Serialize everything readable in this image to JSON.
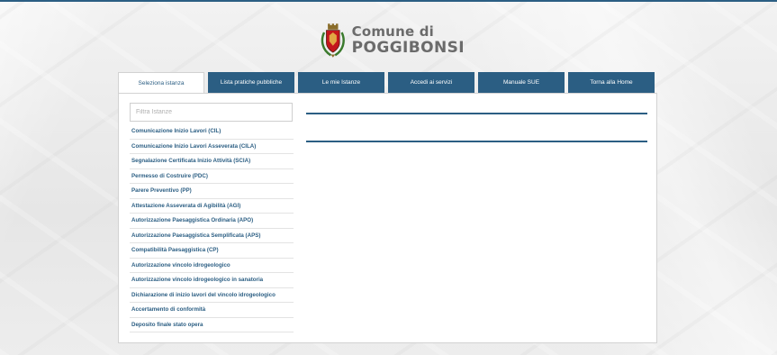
{
  "header": {
    "line1": "Comune di",
    "line2": "POGGIBONSI",
    "crest_icon": "coat-of-arms-icon"
  },
  "tabs": [
    {
      "label": "Seleziona istanza",
      "active": true
    },
    {
      "label": "Lista pratiche pubbliche",
      "active": false
    },
    {
      "label": "Le mie Istanze",
      "active": false
    },
    {
      "label": "Accedi ai servizi",
      "active": false
    },
    {
      "label": "Manuale SUE",
      "active": false
    },
    {
      "label": "Torna alla Home",
      "active": false
    }
  ],
  "filter": {
    "placeholder": "Filtra Istanze",
    "value": ""
  },
  "istanze": [
    "Comunicazione Inizio Lavori (CIL)",
    "Comunicazione Inizio Lavori Asseverata (CILA)",
    "Segnalazione Certificata Inizio Attività (SCIA)",
    "Permesso di Costruire (PDC)",
    "Parere Preventivo (PP)",
    "Attestazione Asseverata di Agibilità (AGI)",
    "Autorizzazione Paesaggistica Ordinaria (APO)",
    "Autorizzazione Paesaggistica Semplificata (APS)",
    "Compatibilità Paesaggistica (CP)",
    "Autorizzazione vincolo idrogeologico",
    "Autorizzazione vincolo idrogeologico in sanatoria",
    "Dichiarazione di inizio lavori del vincolo idrogeologico",
    "Accertamento di conformità",
    "Deposito finale stato opera"
  ],
  "colors": {
    "accent": "#2b5e83",
    "tab_text": "#ffffff",
    "logo_text": "#6b6b6b"
  }
}
